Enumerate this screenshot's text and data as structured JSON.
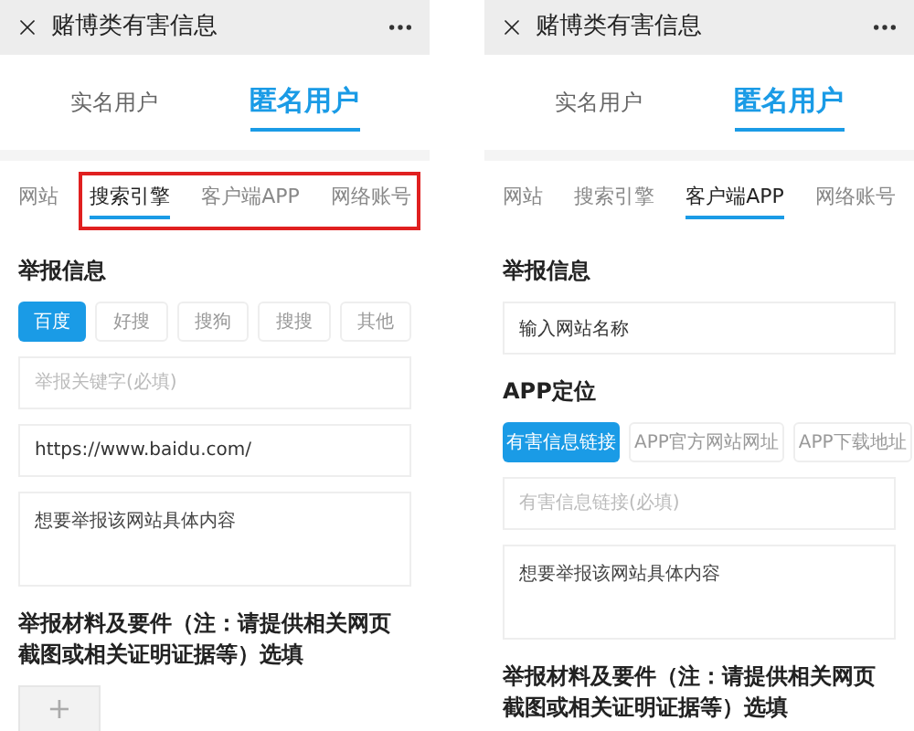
{
  "screens": [
    {
      "title": "赌博类有害信息",
      "user_tabs": [
        {
          "label": "实名用户",
          "selected": false
        },
        {
          "label": "匿名用户",
          "selected": true
        }
      ],
      "category_tabs": {
        "highlighted": true,
        "items": [
          {
            "label": "网站",
            "selected": false
          },
          {
            "label": "搜索引擎",
            "selected": true
          },
          {
            "label": "客户端APP",
            "selected": false
          },
          {
            "label": "网络账号",
            "selected": false
          }
        ]
      },
      "fields": [
        {
          "kind": "heading",
          "text": "举报信息"
        },
        {
          "kind": "chips",
          "items": [
            {
              "label": "百度",
              "selected": true
            },
            {
              "label": "好搜",
              "selected": false
            },
            {
              "label": "搜狗",
              "selected": false
            },
            {
              "label": "搜搜",
              "selected": false
            },
            {
              "label": "其他",
              "selected": false
            }
          ]
        },
        {
          "kind": "input",
          "placeholder": "举报关键字(必填)"
        },
        {
          "kind": "input",
          "value": "https://www.baidu.com/"
        },
        {
          "kind": "textarea",
          "value": "想要举报该网站具体内容"
        },
        {
          "kind": "heading",
          "text": "举报材料及要件（注：请提供相关网页截图或相关证明证据等）选填"
        },
        {
          "kind": "upload",
          "text": "+"
        }
      ]
    },
    {
      "title": "赌博类有害信息",
      "user_tabs": [
        {
          "label": "实名用户",
          "selected": false
        },
        {
          "label": "匿名用户",
          "selected": true
        }
      ],
      "category_tabs": {
        "highlighted": false,
        "items": [
          {
            "label": "网站",
            "selected": false
          },
          {
            "label": "搜索引擎",
            "selected": false
          },
          {
            "label": "客户端APP",
            "selected": true
          },
          {
            "label": "网络账号",
            "selected": false
          }
        ]
      },
      "fields": [
        {
          "kind": "heading",
          "text": "举报信息"
        },
        {
          "kind": "input",
          "value": "输入网站名称"
        },
        {
          "kind": "heading",
          "text": "APP定位"
        },
        {
          "kind": "chips",
          "items": [
            {
              "label": "有害信息链接",
              "selected": true
            },
            {
              "label": "APP官方网站网址",
              "selected": false
            },
            {
              "label": "APP下载地址",
              "selected": false
            }
          ]
        },
        {
          "kind": "input",
          "placeholder": "有害信息链接(必填)"
        },
        {
          "kind": "textarea",
          "value": "想要举报该网站具体内容"
        },
        {
          "kind": "heading",
          "text": "举报材料及要件（注：请提供相关网页截图或相关证明证据等）选填"
        }
      ]
    }
  ]
}
